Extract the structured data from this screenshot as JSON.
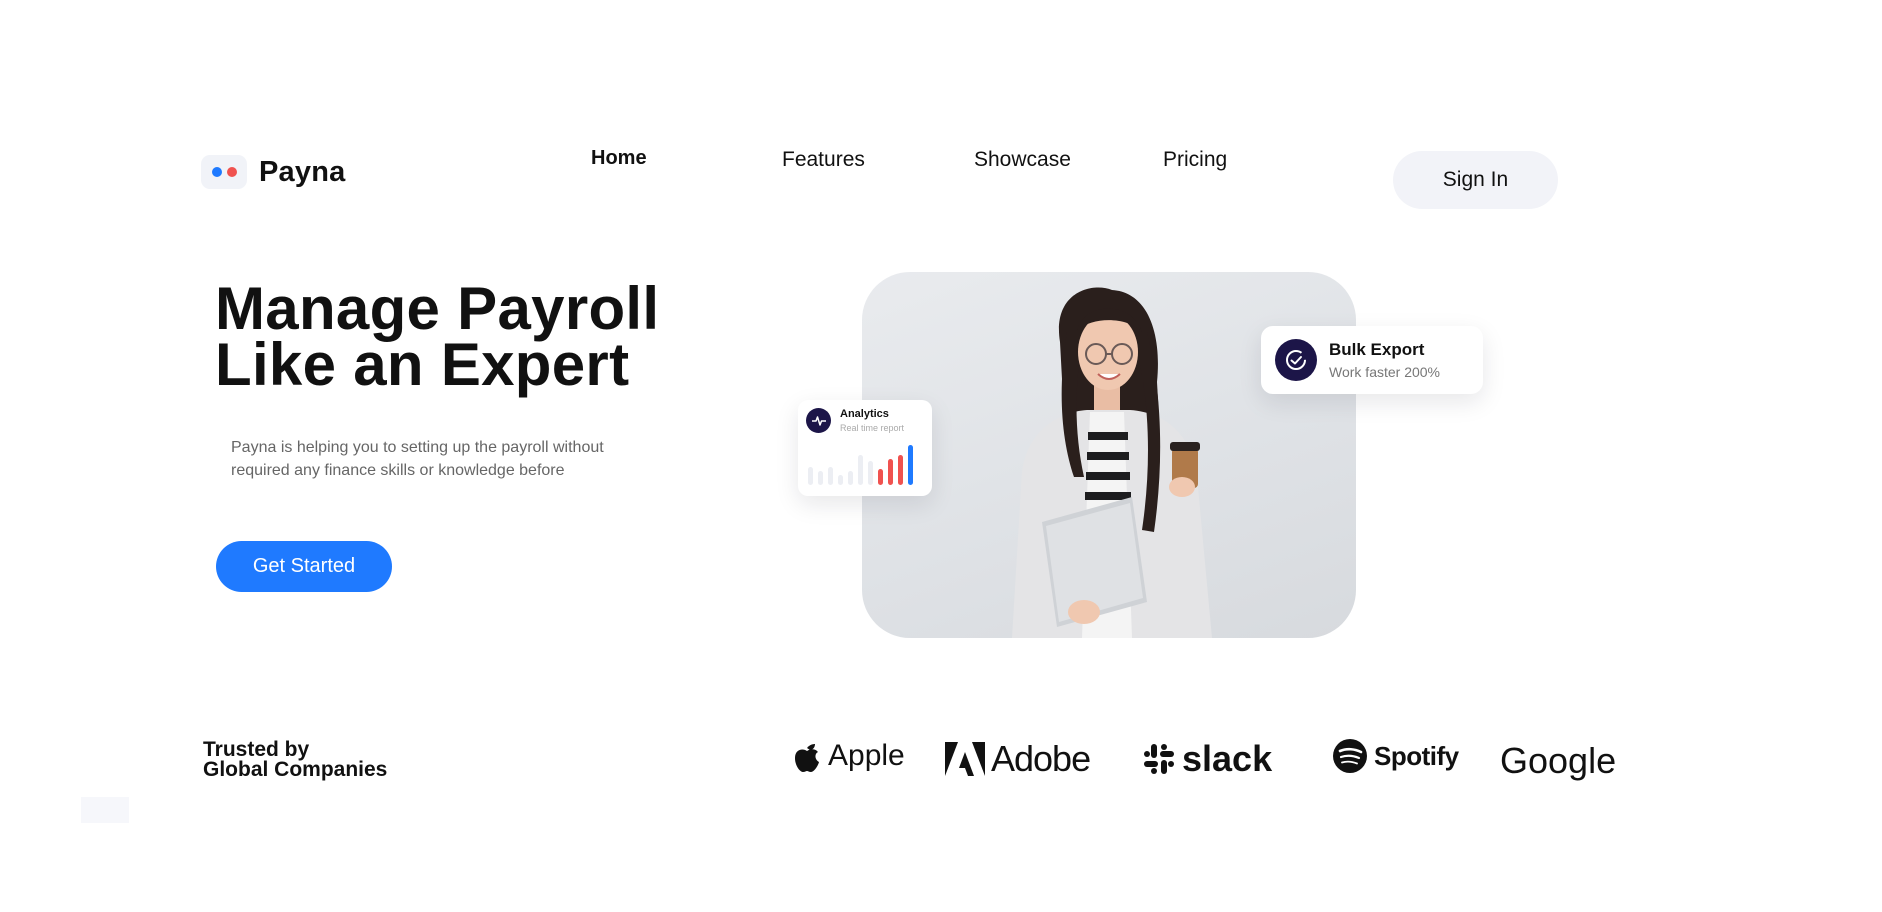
{
  "brand": {
    "name": "Payna",
    "dot_colors": [
      "#1f7aff",
      "#f0524f"
    ]
  },
  "nav": {
    "items": [
      {
        "label": "Home",
        "active": true
      },
      {
        "label": "Features",
        "active": false
      },
      {
        "label": "Showcase",
        "active": false
      },
      {
        "label": "Pricing",
        "active": false
      }
    ],
    "signin_label": "Sign In"
  },
  "hero": {
    "headline_line1": "Manage Payroll",
    "headline_line2": "Like an Expert",
    "subtitle_line1": "Payna is helping you to setting up the payroll without",
    "subtitle_line2": "required any finance skills or knowledge before",
    "cta_label": "Get Started",
    "accent_color": "#1f7aff"
  },
  "cards": {
    "bulk_export": {
      "title": "Bulk Export",
      "subtitle": "Work faster 200%",
      "icon": "check-circle-icon"
    },
    "analytics": {
      "title": "Analytics",
      "subtitle": "Real time report",
      "icon": "pulse-icon",
      "bars": [
        {
          "value": 0.45,
          "color": "#eceef3"
        },
        {
          "value": 0.35,
          "color": "#eceef3"
        },
        {
          "value": 0.45,
          "color": "#eceef3"
        },
        {
          "value": 0.25,
          "color": "#eceef3"
        },
        {
          "value": 0.35,
          "color": "#eceef3"
        },
        {
          "value": 0.75,
          "color": "#eceef3"
        },
        {
          "value": 0.6,
          "color": "#eceef3"
        },
        {
          "value": 0.4,
          "color": "#f0524f"
        },
        {
          "value": 0.65,
          "color": "#f0524f"
        },
        {
          "value": 0.75,
          "color": "#f0524f"
        },
        {
          "value": 1.0,
          "color": "#1f7aff"
        }
      ]
    }
  },
  "trusted": {
    "line1": "Trusted by",
    "line2": "Global Companies",
    "logos": [
      {
        "name": "Apple",
        "icon": "apple-icon"
      },
      {
        "name": "Adobe",
        "icon": "adobe-icon"
      },
      {
        "name": "slack",
        "icon": "slack-icon"
      },
      {
        "name": "Spotify",
        "icon": "spotify-icon"
      },
      {
        "name": "Google",
        "icon": ""
      }
    ]
  }
}
